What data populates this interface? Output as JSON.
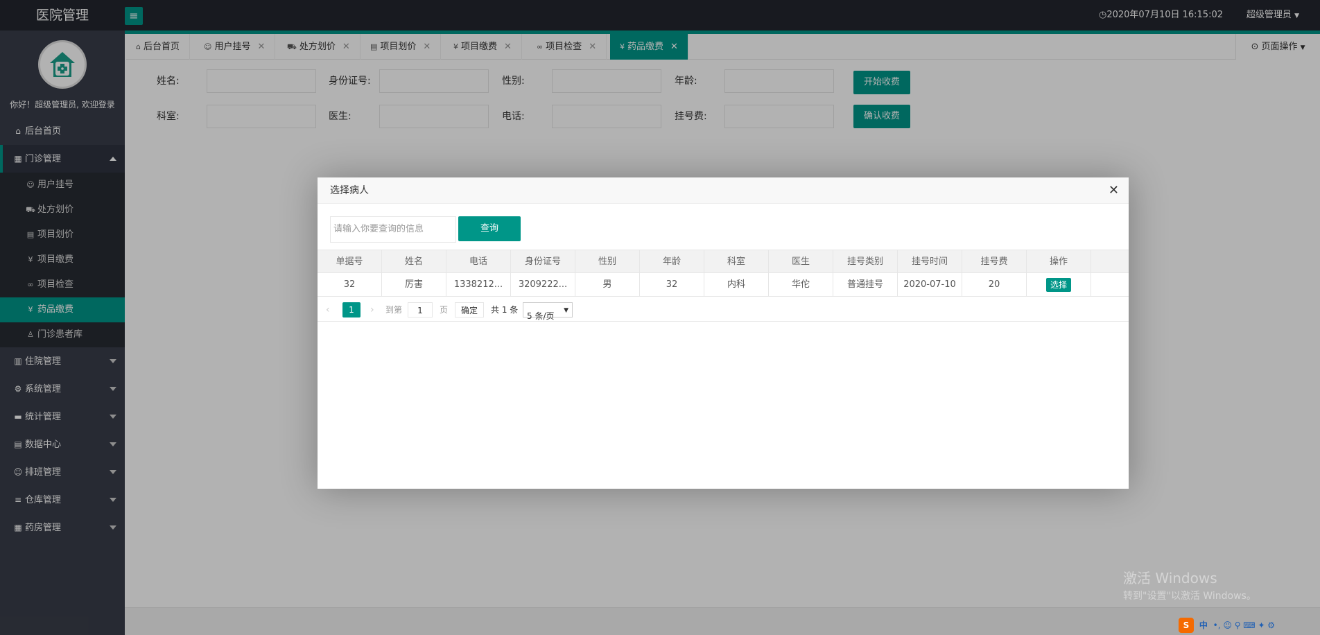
{
  "header": {
    "app_title": "医院管理",
    "menu_toggle": "≡",
    "datetime": "2020年07月10日 16:15:02",
    "user": "超级管理员"
  },
  "sidebar": {
    "welcome": "你好！超级管理员, 欢迎登录",
    "top_item": {
      "label": "后台首页",
      "icon": "home-icon"
    },
    "open_group": {
      "label": "门诊管理",
      "icon": "clinic-icon",
      "items": [
        {
          "label": "用户挂号",
          "icon": "user-icon"
        },
        {
          "label": "处方划价",
          "icon": "cart-icon"
        },
        {
          "label": "项目划价",
          "icon": "doc-icon"
        },
        {
          "label": "项目缴费",
          "icon": "yen-icon"
        },
        {
          "label": "项目检查",
          "icon": "link-icon"
        },
        {
          "label": "药品缴费",
          "icon": "yen-icon",
          "active": true
        },
        {
          "label": "门诊患者库",
          "icon": "person-icon"
        }
      ]
    },
    "groups": [
      {
        "label": "住院管理",
        "icon": "building-icon"
      },
      {
        "label": "系统管理",
        "icon": "gear-icon"
      },
      {
        "label": "统计管理",
        "icon": "monitor-icon"
      },
      {
        "label": "数据中心",
        "icon": "file-icon"
      },
      {
        "label": "排班管理",
        "icon": "people-icon"
      },
      {
        "label": "仓库管理",
        "icon": "stack-icon"
      },
      {
        "label": "药房管理",
        "icon": "book-icon"
      }
    ]
  },
  "tabs": [
    {
      "label": "后台首页",
      "closable": false
    },
    {
      "label": "用户挂号",
      "closable": true
    },
    {
      "label": "处方划价",
      "closable": true
    },
    {
      "label": "项目划价",
      "closable": true
    },
    {
      "label": "项目缴费",
      "closable": true
    },
    {
      "label": "项目检查",
      "closable": true
    },
    {
      "label": "药品缴费",
      "closable": true,
      "active": true
    }
  ],
  "tab_close_glyph": "✕",
  "page_ops": "页面操作",
  "form": {
    "name_label": "姓名:",
    "idcard_label": "身份证号:",
    "gender_label": "性别:",
    "age_label": "年龄:",
    "dept_label": "科室:",
    "doctor_label": "医生:",
    "phone_label": "电话:",
    "fee_label": "挂号费:",
    "start_btn": "开始收费",
    "confirm_btn": "确认收费"
  },
  "modal": {
    "title": "选择病人",
    "close_glyph": "✕",
    "search_placeholder": "请输入你要查询的信息",
    "search_btn": "查询",
    "columns": [
      "单据号",
      "姓名",
      "电话",
      "身份证号",
      "性别",
      "年龄",
      "科室",
      "医生",
      "挂号类别",
      "挂号时间",
      "挂号费",
      "操作"
    ],
    "rows": [
      [
        "32",
        "厉害",
        "1338212...",
        "3209222...",
        "男",
        "32",
        "内科",
        "华佗",
        "普通挂号",
        "2020-07-10",
        "20"
      ]
    ],
    "row_action": "选择",
    "pager": {
      "prev": "‹",
      "current": "1",
      "next": "›",
      "skip_label": "到第",
      "page_input": "1",
      "page_unit": "页",
      "go_btn": "确定",
      "total": "共 1 条",
      "limit": "5 条/页",
      "limit_caret": "▼"
    }
  },
  "watermark": {
    "line1": "激活 Windows",
    "line2": "转到\"设置\"以激活 Windows。"
  },
  "tray": {
    "ime_logo": "S",
    "ime_text": "中",
    "ime_icons": "•, ☺ ⚲ ⌨ ✦ ⚙"
  }
}
